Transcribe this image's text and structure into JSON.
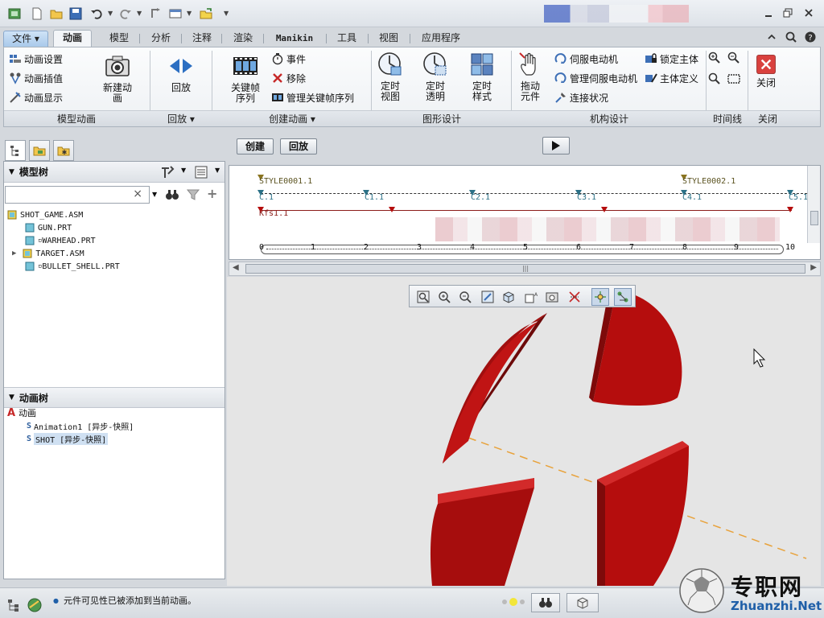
{
  "ribbon": {
    "tabs": [
      "文件",
      "动画",
      "模型",
      "分析",
      "注释",
      "渲染",
      "Manikin",
      "工具",
      "视图",
      "应用程序"
    ],
    "groups": {
      "model_animation": {
        "label": "模型动画",
        "items": [
          "动画设置",
          "动画插值",
          "动画显示"
        ],
        "new_animation": "新建动\n画"
      },
      "playback": {
        "label": "回放",
        "item": "回放"
      },
      "create_animation": {
        "label": "创建动画",
        "keyframe": "关键帧\n序列",
        "event": "事件",
        "remove": "移除",
        "manage_keyframe": "管理关键帧序列"
      },
      "graphic_design": {
        "label": "图形设计",
        "timed_view": "定时\n视图",
        "timed_transparency": "定时\n透明",
        "timed_style": "定时\n样式"
      },
      "mechanism_design": {
        "label": "机构设计",
        "drag": "拖动\n元件",
        "servo_motor": "伺服电动机",
        "manage_servo": "管理伺服电动机",
        "connection_status": "连接状况",
        "lock_body": "锁定主体",
        "body_define": "主体定义"
      },
      "timeline": {
        "label": "时间线"
      },
      "close": {
        "label": "关闭",
        "button": "关闭"
      }
    }
  },
  "mode": {
    "create": "创建",
    "playback": "回放"
  },
  "model_tree": {
    "title": "模型树",
    "items": [
      "SHOT_GAME.ASM",
      "GUN.PRT",
      "WARHEAD.PRT",
      "TARGET.ASM",
      "BULLET_SHELL.PRT"
    ]
  },
  "anim_tree": {
    "title": "动画树",
    "root": "动画",
    "items": [
      "Animation1 [异步-快照]",
      "SHOT [异步-快照]"
    ]
  },
  "timeline": {
    "style_labels": [
      "STYLE0001.1",
      "STYLE0002.1"
    ],
    "c_labels": [
      "C.1",
      "C1.1",
      "C2.1",
      "C3.1",
      "C4.1",
      "C5.1"
    ],
    "kfs_label": "Kfs1.1",
    "ruler_ticks": [
      "0",
      "1",
      "2",
      "3",
      "4",
      "5",
      "6",
      "7",
      "8",
      "9",
      "10"
    ]
  },
  "status": {
    "message": "元件可见性已被添加到当前动画。"
  },
  "watermark": {
    "brand": "专职网",
    "url": "Zhuanzhi.Net"
  },
  "colors": {
    "accent": "#1f5fa8",
    "target_red": "#b50d0d",
    "trajectory": "#e8a23b"
  }
}
